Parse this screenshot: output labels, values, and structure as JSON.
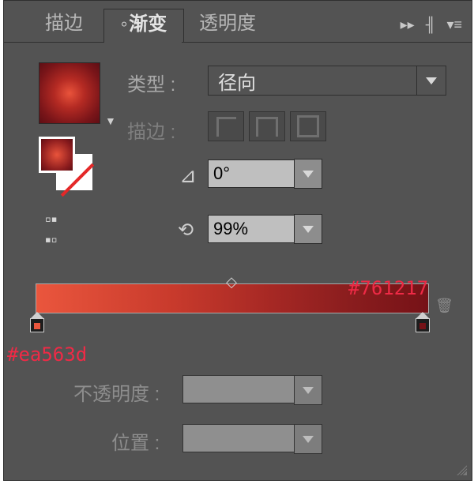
{
  "tabs": {
    "stroke": "描边",
    "gradient": "渐变",
    "transparency": "透明度"
  },
  "labels": {
    "type": "类型 :",
    "stroke": "描边 :",
    "opacity": "不透明度 :",
    "location": "位置 :"
  },
  "type": {
    "value": "径向"
  },
  "angle": {
    "value": "0°"
  },
  "aspect": {
    "value": "99%"
  },
  "gradient": {
    "leftColor": "#ea563d",
    "rightColor": "#761217"
  },
  "annotations": {
    "right": "#761217",
    "left": "#ea563d"
  },
  "icons": {
    "reverse": "⇄",
    "angle": "◿",
    "trash": "🗑"
  }
}
